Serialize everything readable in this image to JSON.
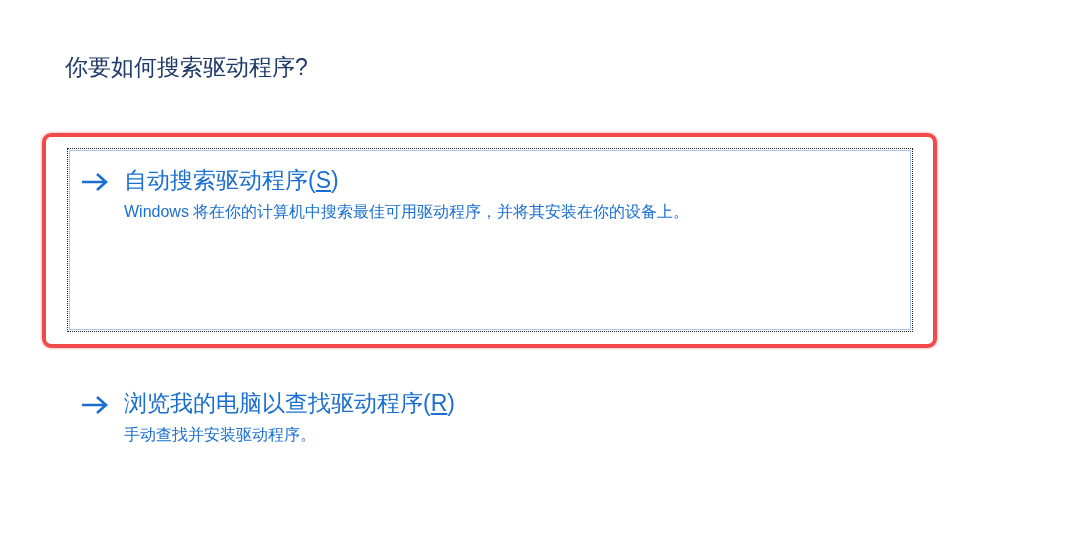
{
  "heading": "你要如何搜索驱动程序?",
  "options": [
    {
      "title_before": "自动搜索驱动程序(",
      "access_key": "S",
      "title_after": ")",
      "description": "Windows 将在你的计算机中搜索最佳可用驱动程序，并将其安装在你的设备上。",
      "focused": true,
      "highlighted": true
    },
    {
      "title_before": "浏览我的电脑以查找驱动程序(",
      "access_key": "R",
      "title_after": ")",
      "description": "手动查找并安装驱动程序。",
      "focused": false,
      "highlighted": false
    }
  ]
}
